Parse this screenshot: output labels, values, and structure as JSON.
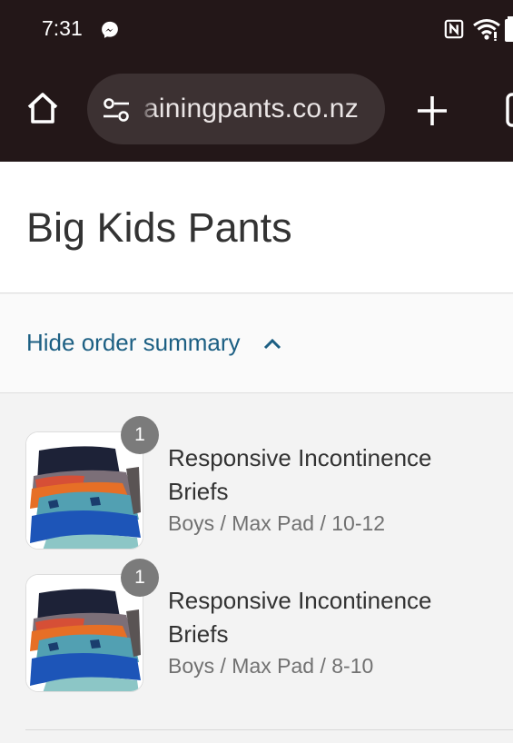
{
  "status_bar": {
    "time": "7:31",
    "icons": [
      "messenger-icon",
      "nfc-icon",
      "wifi-icon",
      "battery-icon"
    ]
  },
  "browser": {
    "url": "ainingpants.co.nz",
    "icons": [
      "home-icon",
      "tune-icon",
      "new-tab-icon",
      "tabs-icon"
    ]
  },
  "header": {
    "title": "Big Kids Pants"
  },
  "order_summary": {
    "toggle_label": "Hide order summary",
    "items": [
      {
        "quantity": "1",
        "title": "Responsive Incontinence Briefs",
        "variant": "Boys / Max Pad / 10-12"
      },
      {
        "quantity": "1",
        "title": "Responsive Incontinence Briefs",
        "variant": "Boys / Max Pad / 8-10"
      }
    ]
  },
  "colors": {
    "chrome": "#231718",
    "url_pill": "#3c3132",
    "link": "#1c5f83",
    "badge": "#7b7b7b"
  }
}
